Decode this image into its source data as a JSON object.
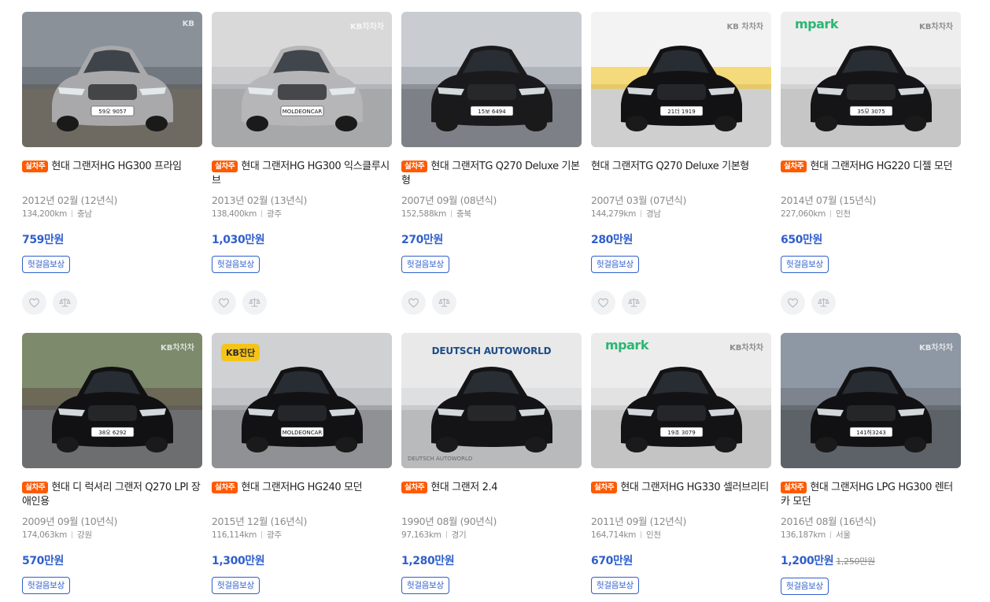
{
  "listings": [
    {
      "tag": "실차주",
      "title": "현대 그랜저HG HG300 프라임",
      "year": "2012년 02월 (12년식)",
      "mileage": "134,200km",
      "region": "충남",
      "price": "759만원",
      "old_price": "",
      "badge": "헛걸음보상",
      "watermark": "KB",
      "plate": "59오 9057",
      "car_color": "#a9a9ab"
    },
    {
      "tag": "실차주",
      "title": "현대 그랜저HG HG300 익스클루시브",
      "year": "2013년 02월 (13년식)",
      "mileage": "138,400km",
      "region": "광주",
      "price": "1,030만원",
      "old_price": "",
      "badge": "헛걸음보상",
      "watermark": "KB차차차",
      "plate": "MOLDEONCAR",
      "car_color": "#b6b6b8"
    },
    {
      "tag": "실차주",
      "title": "현대 그랜저TG Q270 Deluxe 기본형",
      "year": "2007년 09월 (08년식)",
      "mileage": "152,588km",
      "region": "충북",
      "price": "270만원",
      "old_price": "",
      "badge": "헛걸음보상",
      "watermark": "",
      "plate": "15보 6494",
      "car_color": "#1a1a1c"
    },
    {
      "tag": "",
      "title": "현대 그랜저TG Q270 Deluxe 기본형",
      "year": "2007년 03월 (07년식)",
      "mileage": "144,279km",
      "region": "경남",
      "price": "280만원",
      "old_price": "",
      "badge": "헛걸음보상",
      "watermark": "KB 차차차",
      "plate": "21더 1919",
      "car_color": "#121214"
    },
    {
      "tag": "실차주",
      "title": "현대 그랜저HG HG220 디젤 모던",
      "year": "2014년 07월 (15년식)",
      "mileage": "227,060km",
      "region": "인천",
      "price": "650만원",
      "old_price": "",
      "badge": "헛걸음보상",
      "watermark": "KB차차차",
      "mpark": "mpark",
      "plate": "35모 3075",
      "car_color": "#151517"
    },
    {
      "tag": "실차주",
      "title": "현대 디 럭셔리 그랜저 Q270 LPI 장애인용",
      "year": "2009년 09월 (10년식)",
      "mileage": "174,063km",
      "region": "강원",
      "price": "570만원",
      "old_price": "",
      "badge": "헛걸음보상",
      "watermark": "KB차차차",
      "plate": "38오 6292",
      "car_color": "#111113"
    },
    {
      "tag": "실차주",
      "title": "현대 그랜저HG HG240 모던",
      "year": "2015년 12월 (16년식)",
      "mileage": "116,114km",
      "region": "광주",
      "price": "1,300만원",
      "old_price": "",
      "badge": "헛걸음보상",
      "watermark": "",
      "kb_badge": "KB진단",
      "plate": "MOLDEONCAR",
      "car_color": "#121214"
    },
    {
      "tag": "실차주",
      "title": "현대 그랜저 2.4",
      "year": "1990년 08월 (90년식)",
      "mileage": "97,163km",
      "region": "경기",
      "price": "1,280만원",
      "old_price": "",
      "badge": "헛걸음보상",
      "watermark": "",
      "deutsch": "DEUTSCH AUTOWORLD",
      "deutsch_foot": "DEUTSCH AUTOWORLD",
      "plate": "",
      "car_color": "#141416"
    },
    {
      "tag": "실차주",
      "title": "현대 그랜저HG HG330 셀러브리티",
      "year": "2011년 09월 (12년식)",
      "mileage": "164,714km",
      "region": "인천",
      "price": "670만원",
      "old_price": "",
      "badge": "헛걸음보상",
      "watermark": "KB차차차",
      "mpark": "mpark",
      "plate": "19조 3079",
      "car_color": "#131315"
    },
    {
      "tag": "실차주",
      "title": "현대 그랜저HG LPG HG300 렌터카 모던",
      "year": "2016년 08월 (16년식)",
      "mileage": "136,187km",
      "region": "서울",
      "price": "1,200만원",
      "old_price": "1,250만원",
      "badge": "헛걸음보상",
      "watermark": "KB차차차",
      "plate": "141허3243",
      "car_color": "#111113"
    }
  ],
  "icons": {
    "like": "heart-icon",
    "compare": "scale-icon"
  },
  "colors": {
    "accent": "#2f5fcc",
    "tag": "#ff5a00"
  }
}
